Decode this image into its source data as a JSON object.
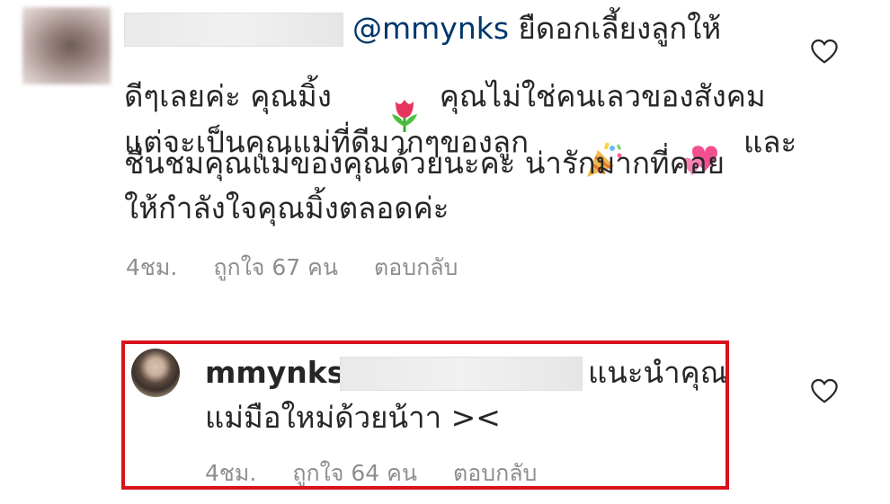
{
  "comments": [
    {
      "mention": "@mmynks",
      "line1_rest": " ยืดอกเลี้ยงลูกให้",
      "line2a": "ดีๆเลยค่ะ คุณมิ้ง",
      "line2b": "  คุณไม่ใช่คนเลวของสังคม",
      "line3a": "แต่จะเป็นคุณแม่ที่ดีมากๆของลูก",
      "line3b": "  และ",
      "line4": "ชื่นชมคุณแม่ของคุณด้วยนะคะ น่ารักมากที่คอย",
      "line5": "ให้กำลังใจคุณมิ้งตลอดค่ะ",
      "time": "4ชม.",
      "likes_label": "ถูกใจ 67 คน",
      "reply_label": "ตอบกลับ",
      "icons": {
        "like": "heart-outline-icon",
        "emoji1": "tulip-emoji",
        "emoji2": "party-popper-emoji",
        "emoji3": "two-hearts-emoji"
      }
    },
    {
      "username": "mmynks",
      "line1_rest": "แนะนำคุณ",
      "line2": "แม่มือใหม่ด้วยน้าา ><",
      "time": "4ชม.",
      "likes_label": "ถูกใจ 64 คน",
      "reply_label": "ตอบกลับ",
      "icons": {
        "like": "heart-outline-icon"
      }
    }
  ],
  "colors": {
    "text": "#262626",
    "mention": "#00376b",
    "meta": "#8e8e8e",
    "highlight": "#d9121b"
  }
}
